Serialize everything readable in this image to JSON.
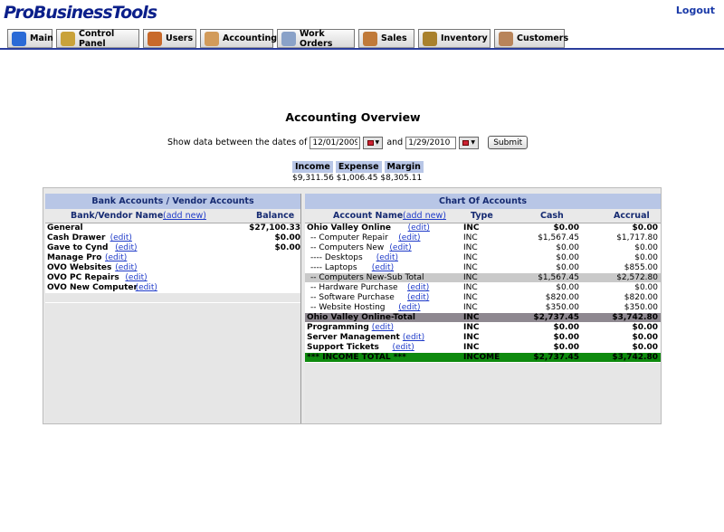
{
  "app": {
    "logo": "ProBusinessTools",
    "logout": "Logout"
  },
  "tabs": [
    {
      "label": "Main",
      "icon": "globe-icon"
    },
    {
      "label": "Control Panel",
      "icon": "tools-icon"
    },
    {
      "label": "Users",
      "icon": "users-icon"
    },
    {
      "label": "Accounting",
      "icon": "accountant-icon"
    },
    {
      "label": "Work Orders",
      "icon": "printer-icon"
    },
    {
      "label": "Sales",
      "icon": "handshake-icon"
    },
    {
      "label": "Inventory",
      "icon": "box-icon"
    },
    {
      "label": "Customers",
      "icon": "customers-icon"
    }
  ],
  "overview": {
    "title": "Accounting Overview",
    "show_label": "Show data between the dates of",
    "start_date": "12/01/2009",
    "and_label": "and",
    "end_date": "1/29/2010",
    "submit": "Submit",
    "income_label": "Income",
    "expense_label": "Expense",
    "margin_label": "Margin",
    "income_value": "$9,311.56",
    "expense_value": "$1,006.45",
    "margin_value": "$8,305.11"
  },
  "bank": {
    "title": "Bank Accounts / Vendor Accounts",
    "col_name": "Bank/Vendor Name",
    "add_new": "(add new)",
    "col_balance": "Balance",
    "edit_label": "(edit)",
    "rows": [
      {
        "name": "General",
        "balance": "$27,100.33",
        "edit": false
      },
      {
        "name": "Cash Drawer",
        "balance": "$0.00",
        "edit": true
      },
      {
        "name": "Gave to Cynd",
        "balance": "$0.00",
        "edit": true
      },
      {
        "name": "Manage Pro",
        "balance": "",
        "edit": true
      },
      {
        "name": "OVO Websites",
        "balance": "",
        "edit": true
      },
      {
        "name": "OVO PC Repairs",
        "balance": "",
        "edit": true
      },
      {
        "name": "OVO New Computer",
        "balance": "",
        "edit": true
      }
    ]
  },
  "chart": {
    "title": "Chart Of Accounts",
    "col_name": "Account Name",
    "add_new": "(add new)",
    "col_type": "Type",
    "col_cash": "Cash",
    "col_accrual": "Accrual",
    "edit_label": "(edit)",
    "rows": [
      {
        "name": "Ohio Valley Online",
        "edit": true,
        "type": "INC",
        "cash": "$0.00",
        "accrual": "$0.00",
        "style": "b"
      },
      {
        "name": "-- Computer Repair",
        "edit": true,
        "type": "INC",
        "cash": "$1,567.45",
        "accrual": "$1,717.80",
        "style": ""
      },
      {
        "name": "-- Computers New",
        "edit": true,
        "type": "INC",
        "cash": "$0.00",
        "accrual": "$0.00",
        "style": ""
      },
      {
        "name": "---- Desktops",
        "edit": true,
        "type": "INC",
        "cash": "$0.00",
        "accrual": "$0.00",
        "style": ""
      },
      {
        "name": "---- Laptops",
        "edit": true,
        "type": "INC",
        "cash": "$0.00",
        "accrual": "$855.00",
        "style": ""
      },
      {
        "name": "-- Computers New-Sub Total",
        "edit": false,
        "type": "INC",
        "cash": "$1,567.45",
        "accrual": "$2,572.80",
        "style": "sub"
      },
      {
        "name": "-- Hardware Purchase",
        "edit": true,
        "type": "INC",
        "cash": "$0.00",
        "accrual": "$0.00",
        "style": ""
      },
      {
        "name": "-- Software Purchase",
        "edit": true,
        "type": "INC",
        "cash": "$820.00",
        "accrual": "$820.00",
        "style": ""
      },
      {
        "name": "-- Website Hosting",
        "edit": true,
        "type": "INC",
        "cash": "$350.00",
        "accrual": "$350.00",
        "style": ""
      },
      {
        "name": "Ohio Valley Online-Total",
        "edit": false,
        "type": "INC",
        "cash": "$2,737.45",
        "accrual": "$3,742.80",
        "style": "tot"
      },
      {
        "name": "Programming",
        "edit": true,
        "type": "INC",
        "cash": "$0.00",
        "accrual": "$0.00",
        "style": "b"
      },
      {
        "name": "Server Management",
        "edit": true,
        "type": "INC",
        "cash": "$0.00",
        "accrual": "$0.00",
        "style": "b"
      },
      {
        "name": "Support Tickets",
        "edit": true,
        "type": "INC",
        "cash": "$0.00",
        "accrual": "$0.00",
        "style": "b"
      },
      {
        "name": "*** INCOME TOTAL ***",
        "edit": false,
        "type": "INCOME",
        "cash": "$2,737.45",
        "accrual": "$3,742.80",
        "style": "grand"
      }
    ]
  }
}
